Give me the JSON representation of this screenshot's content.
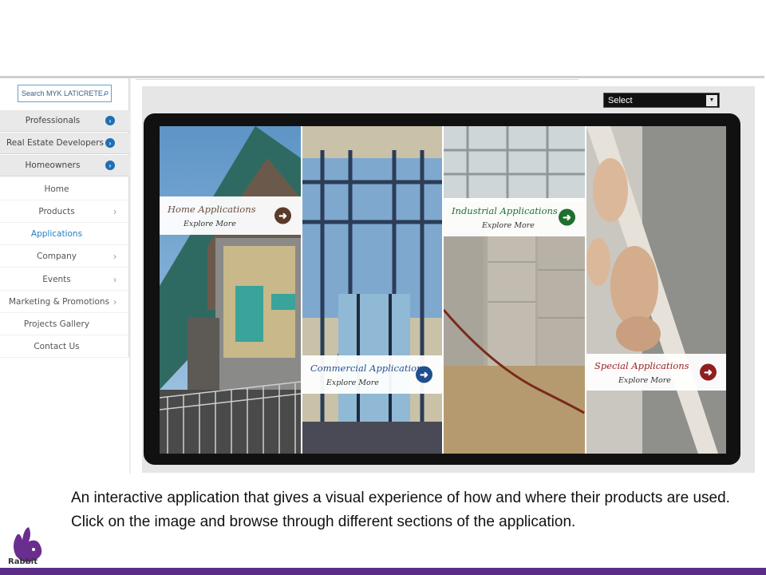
{
  "sidebar": {
    "search_placeholder": "Search MYK LATICRETE",
    "audience_items": [
      {
        "label": "Professionals"
      },
      {
        "label": "Real Estate Developers"
      },
      {
        "label": "Homeowners"
      }
    ],
    "nav_items": [
      {
        "label": "Home",
        "has_submenu": false,
        "active": false
      },
      {
        "label": "Products",
        "has_submenu": true,
        "active": false
      },
      {
        "label": "Applications",
        "has_submenu": false,
        "active": true
      },
      {
        "label": "Company",
        "has_submenu": true,
        "active": false
      },
      {
        "label": "Events",
        "has_submenu": true,
        "active": false
      },
      {
        "label": "Marketing & Promotions",
        "has_submenu": true,
        "active": false
      },
      {
        "label": "Projects Gallery",
        "has_submenu": false,
        "active": false
      },
      {
        "label": "Contact Us",
        "has_submenu": false,
        "active": false
      }
    ]
  },
  "select": {
    "value": "Select"
  },
  "tiles": [
    {
      "title": "Home Applications",
      "link": "Explore More",
      "accent": "#5a3a2a"
    },
    {
      "title": "Commercial Applications",
      "link": "Explore More",
      "accent": "#1f4f8f"
    },
    {
      "title": "Industrial  Applications",
      "link": "Explore More",
      "accent": "#1f6f2f"
    },
    {
      "title": "Special Applications",
      "link": "Explore More",
      "accent": "#8f1f1f"
    }
  ],
  "colors": {
    "home_title": "#6a4a3a",
    "commercial_title": "#1f4f8f",
    "industrial_title": "#1f6f2f",
    "special_title": "#a01f1f",
    "brand_purple": "#5c2d86",
    "active_nav": "#1f7fc4"
  },
  "caption": "An interactive application that gives a visual experience of how and where their products are used. Click on the image and browse through different sections of the application.",
  "logo": {
    "text": "Rabbit"
  }
}
